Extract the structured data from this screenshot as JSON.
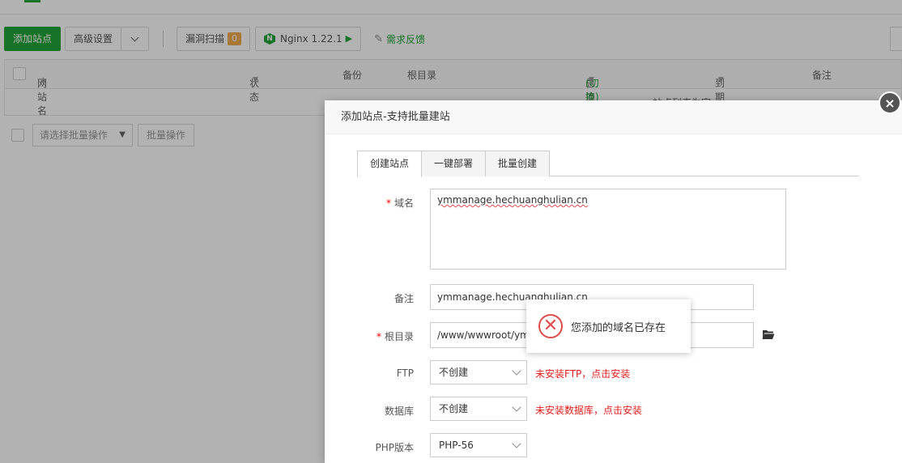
{
  "toolbar": {
    "add_site": "添加站点",
    "advanced_settings": "高级设置",
    "vuln_scan": "漏洞扫描",
    "vuln_count": "0",
    "nginx": "Nginx 1.22.1",
    "feedback": "需求反馈"
  },
  "table": {
    "col_site_name": "网站名",
    "col_status": "状态",
    "col_backup": "备份",
    "col_root": "根目录",
    "col_traffic": "总流量",
    "col_traffic_switch": "(切换)",
    "col_expire": "到期时间",
    "col_remark": "备注",
    "empty_text": "站点列表为空"
  },
  "batch": {
    "select_placeholder": "请选择批量操作",
    "button": "批量操作"
  },
  "modal": {
    "title": "添加站点-支持批量建站",
    "close": "×",
    "tabs": [
      "创建站点",
      "一键部署",
      "批量创建"
    ],
    "labels": {
      "domain": "域名",
      "remark": "备注",
      "root": "根目录",
      "ftp": "FTP",
      "database": "数据库",
      "php": "PHP版本"
    },
    "required_mark": "*",
    "domain_value": "ymmanage.hechuanghulian.cn",
    "remark_value": "ymmanage.hechuanghulian.cn",
    "root_value": "/www/wwwroot/ymmanage.hechuanghulian.cn",
    "ftp_value": "不创建",
    "ftp_hint": "未安装FTP，点击安装",
    "db_value": "不创建",
    "db_hint": "未安装数据库，点击安装",
    "php_value": "PHP-56"
  },
  "toast": {
    "message": "您添加的域名已存在"
  },
  "colors": {
    "accent": "#20a53a",
    "error": "#e04b4b",
    "badge": "#f0ad4e"
  }
}
